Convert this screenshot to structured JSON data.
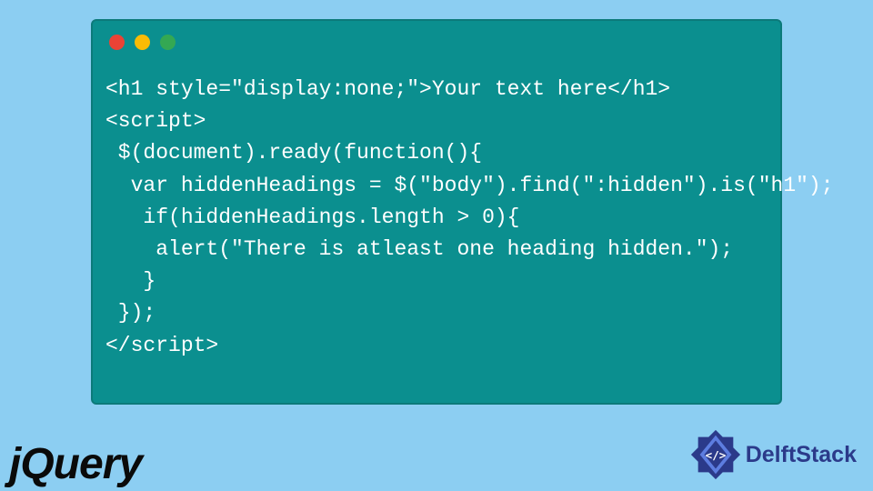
{
  "code": {
    "line1": "<h1 style=\"display:none;\">Your text here</h1>",
    "line2": "<script>",
    "line3": " $(document).ready(function(){",
    "line4": "  var hiddenHeadings = $(\"body\").find(\":hidden\").is(\"h1\");",
    "line5": "   if(hiddenHeadings.length > 0){",
    "line6": "    alert(\"There is atleast one heading hidden.\");",
    "line7": "   }",
    "line8": " });",
    "line9": "</script>"
  },
  "logos": {
    "jquery": "jQuery",
    "delft_prefix": "Delft",
    "delft_suffix": "Stack"
  }
}
